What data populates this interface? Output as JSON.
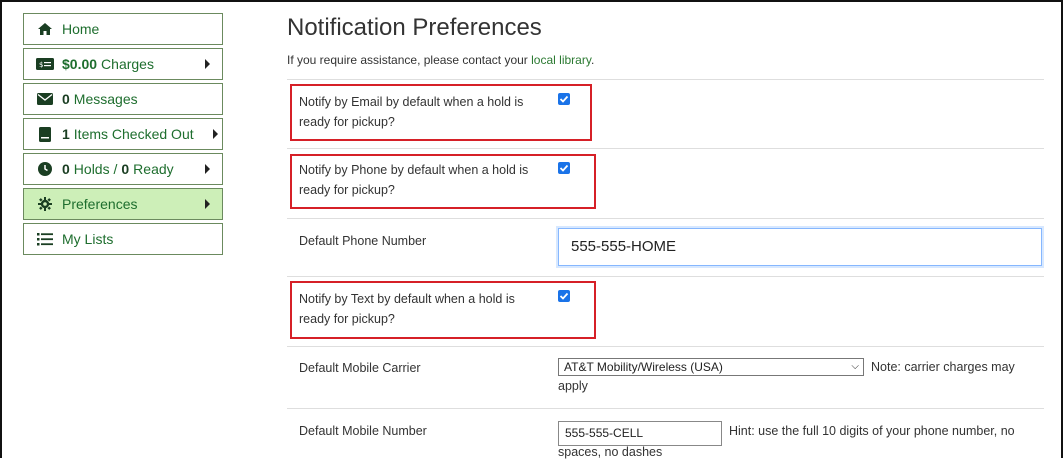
{
  "sidebar": {
    "items": [
      {
        "icon": "home-icon",
        "num": "",
        "label": "Home"
      },
      {
        "icon": "money-icon",
        "num": "$0.00",
        "label": "Charges"
      },
      {
        "icon": "envelope-icon",
        "num": "0",
        "label": "Messages"
      },
      {
        "icon": "book-icon",
        "num": "1",
        "label": "Items Checked Out"
      },
      {
        "icon": "clock-icon",
        "num": "0",
        "label": "Holds /",
        "num2": "0",
        "label2": "Ready"
      },
      {
        "icon": "gear-icon",
        "num": "",
        "label": "Preferences",
        "active": true
      },
      {
        "icon": "list-icon",
        "num": "",
        "label": "My Lists"
      }
    ]
  },
  "main": {
    "title": "Notification Preferences",
    "help_text": "If you require assistance, please contact your",
    "help_link": "local library",
    "help_end": ".",
    "rows": {
      "email_label": "Notify by Email by default when a hold is ready for pickup?",
      "email_checked": true,
      "phone_label": "Notify by Phone by default when a hold is ready for pickup?",
      "phone_checked": true,
      "default_phone_label": "Default Phone Number",
      "default_phone_value": "555-555-HOME",
      "text_label": "Notify by Text by default when a hold is ready for pickup?",
      "text_checked": true,
      "carrier_label": "Default Mobile Carrier",
      "carrier_value": "AT&T Mobility/Wireless (USA)",
      "carrier_note": "Note: carrier charges may apply",
      "mobile_label": "Default Mobile Number",
      "mobile_value": "555-555-CELL",
      "mobile_hint": "Hint: use the full 10 digits of your phone number, no spaces, no dashes"
    }
  },
  "colors": {
    "accent": "#1e6e2e",
    "active_bg": "#cdefb8",
    "highlight_border": "#d62027",
    "checkbox": "#1a73e8"
  }
}
